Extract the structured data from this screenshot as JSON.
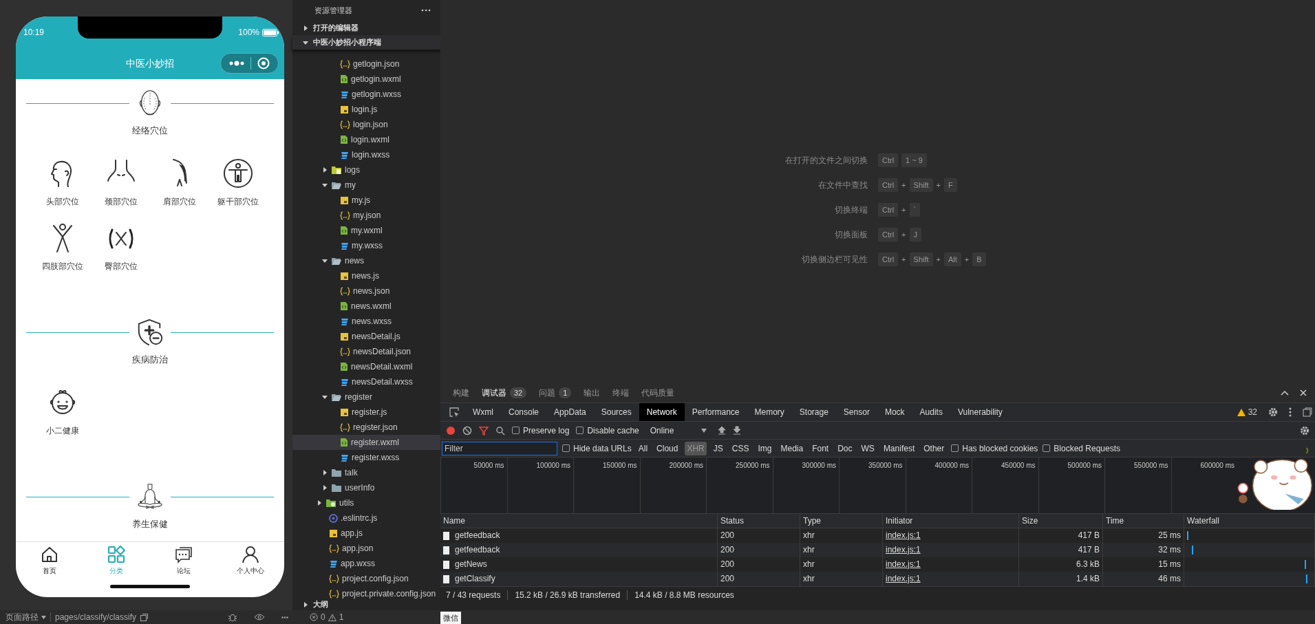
{
  "simulator": {
    "status_time": "10:19",
    "battery": "100%",
    "title": "中医小妙招",
    "sections": [
      {
        "title": "经络穴位",
        "items": [
          {
            "label": "头部穴位"
          },
          {
            "label": "颈部穴位"
          },
          {
            "label": "肩部穴位"
          },
          {
            "label": "躯干部穴位"
          },
          {
            "label": "四肢部穴位"
          },
          {
            "label": "臀部穴位"
          }
        ]
      },
      {
        "title": "疾病防治",
        "items": [
          {
            "label": "小二健康"
          }
        ]
      },
      {
        "title": "养生保健"
      }
    ],
    "tabbar": [
      {
        "label": "首页",
        "selected": false
      },
      {
        "label": "分类",
        "selected": true
      },
      {
        "label": "论坛",
        "selected": false
      },
      {
        "label": "个人中心",
        "selected": false
      }
    ]
  },
  "path_bar": {
    "label": "页面路径",
    "path": "pages/classify/classify"
  },
  "explorer": {
    "title": "资源管理器",
    "open_editors": {
      "label": "打开的编辑器",
      "expanded": false
    },
    "project": {
      "label": "中医小妙招小程序端",
      "expanded": true,
      "children": [
        {
          "children": [
            {
              "children": [
                {
                  "label": "getlogin.json",
                  "kind": "json",
                  "selected": false
                },
                {
                  "label": "getlogin.wxml",
                  "kind": "wxml",
                  "selected": false
                },
                {
                  "label": "getlogin.wxss",
                  "kind": "wxss",
                  "selected": false
                },
                {
                  "label": "login.js",
                  "kind": "js",
                  "selected": false
                },
                {
                  "label": "login.json",
                  "kind": "json",
                  "selected": false
                },
                {
                  "label": "login.wxml",
                  "kind": "wxml",
                  "selected": false
                },
                {
                  "label": "login.wxss",
                  "kind": "wxss",
                  "selected": false
                }
              ]
            },
            {
              "label": "logs",
              "kind": "logfolder",
              "expanded": false,
              "selected": false
            },
            {
              "label": "my",
              "kind": "folder",
              "expanded": true,
              "selected": false,
              "children": [
                {
                  "label": "my.js",
                  "kind": "js",
                  "selected": false
                },
                {
                  "label": "my.json",
                  "kind": "json",
                  "selected": false
                },
                {
                  "label": "my.wxml",
                  "kind": "wxml",
                  "selected": false
                },
                {
                  "label": "my.wxss",
                  "kind": "wxss",
                  "selected": false
                }
              ]
            },
            {
              "label": "news",
              "kind": "folder",
              "expanded": true,
              "selected": false,
              "children": [
                {
                  "label": "news.js",
                  "kind": "js",
                  "selected": false
                },
                {
                  "label": "news.json",
                  "kind": "json",
                  "selected": false
                },
                {
                  "label": "news.wxml",
                  "kind": "wxml",
                  "selected": false
                },
                {
                  "label": "news.wxss",
                  "kind": "wxss",
                  "selected": false
                },
                {
                  "label": "newsDetail.js",
                  "kind": "js",
                  "selected": false
                },
                {
                  "label": "newsDetail.json",
                  "kind": "json",
                  "selected": false
                },
                {
                  "label": "newsDetail.wxml",
                  "kind": "wxml",
                  "selected": false
                },
                {
                  "label": "newsDetail.wxss",
                  "kind": "wxss",
                  "selected": false
                }
              ]
            },
            {
              "label": "register",
              "kind": "folder",
              "expanded": true,
              "selected": false,
              "children": [
                {
                  "label": "register.js",
                  "kind": "js",
                  "selected": false
                },
                {
                  "label": "register.json",
                  "kind": "json",
                  "selected": false
                },
                {
                  "label": "register.wxml",
                  "kind": "wxml",
                  "selected": true
                },
                {
                  "label": "register.wxss",
                  "kind": "wxss",
                  "selected": false
                }
              ]
            },
            {
              "label": "talk",
              "kind": "folder",
              "expanded": false,
              "selected": false
            },
            {
              "label": "userInfo",
              "kind": "folder",
              "expanded": false,
              "selected": false
            }
          ]
        },
        {
          "label": "utils",
          "kind": "libfolder",
          "expanded": false,
          "selected": false
        },
        {
          "label": ".eslintrc.js",
          "kind": "eslint",
          "selected": false
        },
        {
          "label": "app.js",
          "kind": "js",
          "selected": false
        },
        {
          "label": "app.json",
          "kind": "json",
          "selected": false
        },
        {
          "label": "app.wxss",
          "kind": "wxss",
          "selected": false
        },
        {
          "label": "project.config.json",
          "kind": "json",
          "selected": false
        },
        {
          "label": "project.private.config.json",
          "kind": "json",
          "selected": false
        }
      ]
    },
    "outline": {
      "label": "大纲",
      "expanded": false
    },
    "errors": "0",
    "warnings": "1"
  },
  "editor_hints": [
    {
      "label": "在打开的文件之间切换",
      "keys": [
        {
          "kind": "key",
          "text": "Ctrl"
        },
        {
          "kind": "key",
          "text": "1 ~ 9"
        }
      ]
    },
    {
      "label": "在文件中查找",
      "keys": [
        {
          "kind": "key",
          "text": "Ctrl"
        },
        {
          "kind": "plus",
          "text": "+"
        },
        {
          "kind": "key",
          "text": "Shift"
        },
        {
          "kind": "plus",
          "text": "+"
        },
        {
          "kind": "key",
          "text": "F"
        }
      ]
    },
    {
      "label": "切换终端",
      "keys": [
        {
          "kind": "key",
          "text": "Ctrl"
        },
        {
          "kind": "plus",
          "text": "+"
        },
        {
          "kind": "key",
          "text": "`"
        }
      ]
    },
    {
      "label": "切换面板",
      "keys": [
        {
          "kind": "key",
          "text": "Ctrl"
        },
        {
          "kind": "plus",
          "text": "+"
        },
        {
          "kind": "key",
          "text": "J"
        }
      ]
    },
    {
      "label": "切换侧边栏可见性",
      "keys": [
        {
          "kind": "key",
          "text": "Ctrl"
        },
        {
          "kind": "plus",
          "text": "+"
        },
        {
          "kind": "key",
          "text": "Shift"
        },
        {
          "kind": "plus",
          "text": "+"
        },
        {
          "kind": "key",
          "text": "Alt"
        },
        {
          "kind": "plus",
          "text": "+"
        },
        {
          "kind": "key",
          "text": "B"
        }
      ]
    }
  ],
  "devtools": {
    "panel_tabs": [
      {
        "label": "构建",
        "selected": false
      },
      {
        "label": "调试器",
        "badge": "32",
        "selected": true
      },
      {
        "label": "问题",
        "badge": "1",
        "selected": false
      },
      {
        "label": "输出",
        "selected": false
      },
      {
        "label": "终端",
        "selected": false
      },
      {
        "label": "代码质量",
        "selected": false
      }
    ],
    "tools": [
      {
        "label": "Wxml",
        "selected": false
      },
      {
        "label": "Console",
        "selected": false
      },
      {
        "label": "AppData",
        "selected": false
      },
      {
        "label": "Sources",
        "selected": false
      },
      {
        "label": "Network",
        "selected": true
      },
      {
        "label": "Performance",
        "selected": false
      },
      {
        "label": "Memory",
        "selected": false
      },
      {
        "label": "Storage",
        "selected": false
      },
      {
        "label": "Sensor",
        "selected": false
      },
      {
        "label": "Mock",
        "selected": false
      },
      {
        "label": "Audits",
        "selected": false
      },
      {
        "label": "Vulnerability",
        "selected": false
      }
    ],
    "warning_count": "32",
    "toolbar": {
      "preserve_log": {
        "label": "Preserve log",
        "checked": false
      },
      "disable_cache": {
        "label": "Disable cache",
        "checked": false
      },
      "throttling": "Online"
    },
    "filter": {
      "placeholder": "Filter",
      "hide_data_urls": {
        "label": "Hide data URLs",
        "checked": false
      },
      "types": [
        {
          "label": "All",
          "selected": false
        },
        {
          "label": "Cloud",
          "selected": false
        },
        {
          "label": "XHR",
          "selected": true
        },
        {
          "label": "JS",
          "selected": false
        },
        {
          "label": "CSS",
          "selected": false
        },
        {
          "label": "Img",
          "selected": false
        },
        {
          "label": "Media",
          "selected": false
        },
        {
          "label": "Font",
          "selected": false
        },
        {
          "label": "Doc",
          "selected": false
        },
        {
          "label": "WS",
          "selected": false
        },
        {
          "label": "Manifest",
          "selected": false
        },
        {
          "label": "Other",
          "selected": false
        }
      ],
      "has_blocked_cookies": {
        "label": "Has blocked cookies",
        "checked": false
      },
      "blocked_requests": {
        "label": "Blocked Requests",
        "checked": false
      }
    },
    "timeline_ticks": [
      "50000 ms",
      "100000 ms",
      "150000 ms",
      "200000 ms",
      "250000 ms",
      "300000 ms",
      "350000 ms",
      "400000 ms",
      "450000 ms",
      "500000 ms",
      "550000 ms",
      "600000 ms"
    ],
    "table": {
      "columns": [
        "Name",
        "Status",
        "Type",
        "Initiator",
        "Size",
        "Time",
        "Waterfall"
      ],
      "rows": [
        {
          "name": "getfeedback",
          "status": "200",
          "type": "xhr",
          "initiator": "index.js:1",
          "size": "417 B",
          "time": "25 ms"
        },
        {
          "name": "getfeedback",
          "status": "200",
          "type": "xhr",
          "initiator": "index.js:1",
          "size": "417 B",
          "time": "32 ms"
        },
        {
          "name": "getNews",
          "status": "200",
          "type": "xhr",
          "initiator": "index.js:1",
          "size": "6.3 kB",
          "time": "15 ms"
        },
        {
          "name": "getClassify",
          "status": "200",
          "type": "xhr",
          "initiator": "index.js:1",
          "size": "1.4 kB",
          "time": "46 ms"
        }
      ]
    },
    "summary": [
      "7 / 43 requests",
      "15.2 kB / 26.9 kB transferred",
      "14.4 kB / 8.8 MB resources"
    ]
  },
  "bottom_tab": "微信"
}
